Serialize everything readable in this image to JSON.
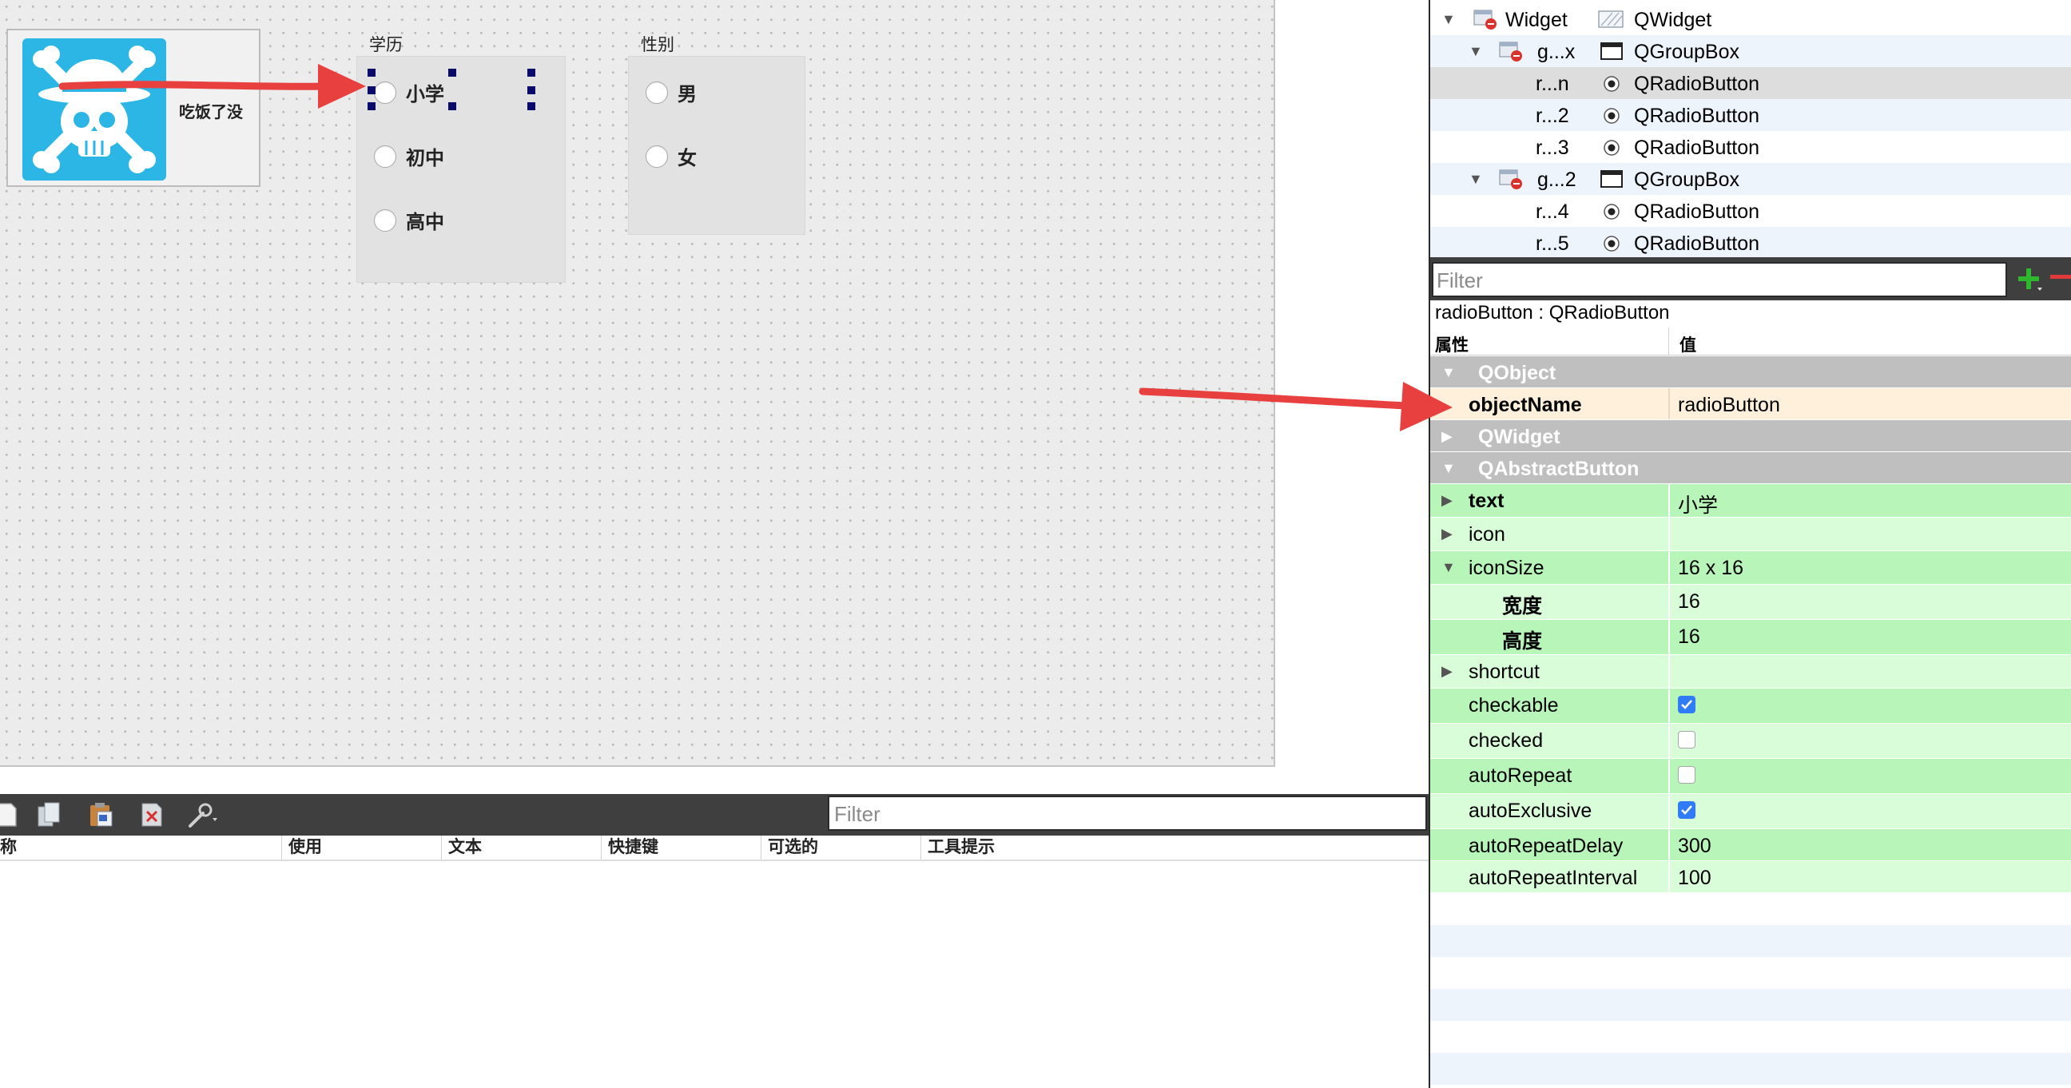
{
  "canvas": {
    "avatar_label": "吃饭了没",
    "groups": [
      {
        "title": "学历",
        "options": [
          "小学",
          "初中",
          "高中"
        ]
      },
      {
        "title": "性别",
        "options": [
          "男",
          "女"
        ]
      }
    ]
  },
  "action_editor": {
    "filter_placeholder": "Filter",
    "columns": [
      "称",
      "使用",
      "文本",
      "快捷键",
      "可选的",
      "工具提示"
    ]
  },
  "object_inspector": {
    "rows": [
      {
        "name": "Widget",
        "class": "QWidget"
      },
      {
        "name": "g...x",
        "class": "QGroupBox"
      },
      {
        "name": "r...n",
        "class": "QRadioButton"
      },
      {
        "name": "r...2",
        "class": "QRadioButton"
      },
      {
        "name": "r...3",
        "class": "QRadioButton"
      },
      {
        "name": "g...2",
        "class": "QGroupBox"
      },
      {
        "name": "r...4",
        "class": "QRadioButton"
      },
      {
        "name": "r...5",
        "class": "QRadioButton"
      }
    ]
  },
  "property_editor": {
    "filter_placeholder": "Filter",
    "caption": "radioButton : QRadioButton",
    "col_property": "属性",
    "col_value": "值",
    "sections": {
      "qobject": "QObject",
      "qwidget": "QWidget",
      "qabstractbutton": "QAbstractButton"
    },
    "object_name": {
      "key": "objectName",
      "value": "radioButton"
    },
    "props": {
      "text": {
        "key": "text",
        "value": "小学"
      },
      "icon": {
        "key": "icon",
        "value": ""
      },
      "iconSize": {
        "key": "iconSize",
        "value": "16 x 16"
      },
      "width": {
        "key": "宽度",
        "value": "16"
      },
      "height": {
        "key": "高度",
        "value": "16"
      },
      "shortcut": {
        "key": "shortcut",
        "value": ""
      },
      "checkable": {
        "key": "checkable",
        "checked": true
      },
      "checked": {
        "key": "checked",
        "checked": false
      },
      "autoRepeat": {
        "key": "autoRepeat",
        "checked": false
      },
      "autoExclusive": {
        "key": "autoExclusive",
        "checked": true
      },
      "autoRepeatDelay": {
        "key": "autoRepeatDelay",
        "value": "300"
      },
      "autoRepeatInterval": {
        "key": "autoRepeatInterval",
        "value": "100"
      }
    }
  },
  "colors": {
    "accent_arrow": "#e8403f",
    "checkbox_on": "#2f7cf6",
    "prop_green": "#b8f5b8"
  }
}
